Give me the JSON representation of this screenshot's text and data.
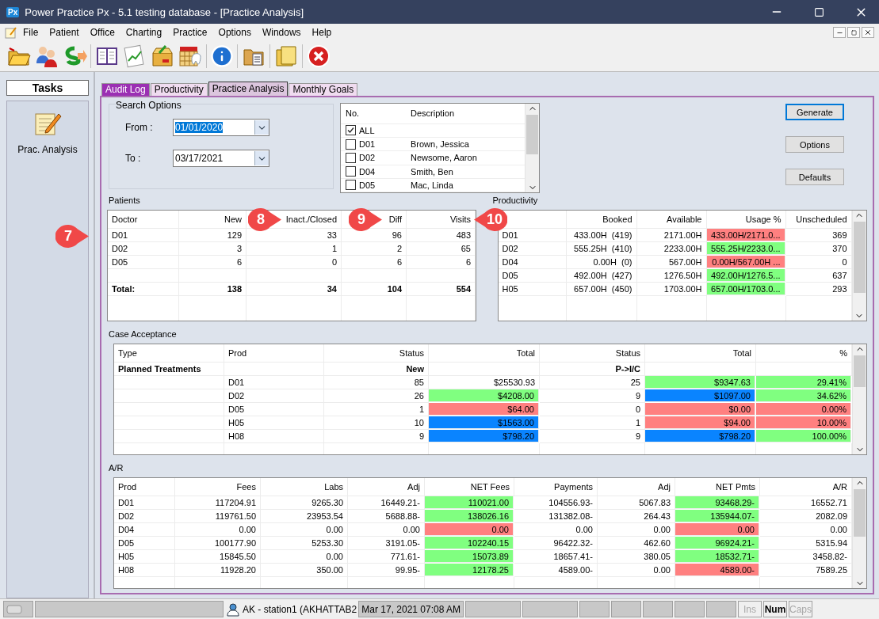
{
  "window": {
    "logo": "Px",
    "title": "Power Practice Px - 5.1 testing database - [Practice Analysis]"
  },
  "menu": [
    "File",
    "Patient",
    "Office",
    "Charting",
    "Practice",
    "Options",
    "Windows",
    "Help"
  ],
  "sidebar": {
    "title": "Tasks",
    "items": [
      {
        "label": "Prac. Analysis"
      }
    ]
  },
  "tabs": [
    {
      "label": "Audit Log",
      "selected": false,
      "color": "#9b2fb3"
    },
    {
      "label": "Productivity",
      "selected": false,
      "color": "#f0dcf0"
    },
    {
      "label": "Practice Analysis",
      "selected": true,
      "color": "#dcc6de"
    },
    {
      "label": "Monthly Goals",
      "selected": false,
      "color": "#f0dcf0"
    }
  ],
  "search": {
    "title": "Search Options",
    "fields": [
      {
        "label": "From :",
        "value": "01/01/2020",
        "selected": true
      },
      {
        "label": "To :",
        "value": "03/17/2021",
        "selected": false
      }
    ]
  },
  "doctor_list": {
    "columns": [
      "No.",
      "Description"
    ],
    "rows": [
      {
        "code": "ALL",
        "checked": true
      },
      {
        "code": "D01",
        "name": "Brown, Jessica",
        "checked": false
      },
      {
        "code": "D02",
        "name": "Newsome, Aaron",
        "checked": false
      },
      {
        "code": "D04",
        "name": "Smith, Ben",
        "checked": false
      },
      {
        "code": "D05",
        "name": "Mac, Linda",
        "checked": false
      }
    ]
  },
  "buttons": [
    {
      "label": "Generate",
      "default": true
    },
    {
      "label": "Options",
      "default": false
    },
    {
      "label": "Defaults",
      "default": false
    }
  ],
  "patients": {
    "title": "Patients",
    "columns": [
      "Doctor",
      "New",
      "Inact./Closed",
      "Diff",
      "Visits"
    ],
    "rows": [
      [
        "D01",
        "129",
        "33",
        "96",
        "483"
      ],
      [
        "D02",
        "3",
        "1",
        "2",
        "65"
      ],
      [
        "D05",
        "6",
        "0",
        "6",
        "6"
      ]
    ],
    "total": [
      "Total:",
      "138",
      "34",
      "104",
      "554"
    ]
  },
  "productivity": {
    "title": "Productivity",
    "columns": [
      "",
      "Booked",
      "Available",
      "Usage %",
      "Unscheduled"
    ],
    "rows": [
      [
        "D01",
        "433.00H  (419)",
        "2171.00H",
        {
          "text": "433.00H/2171.0...",
          "color": "#ff8080"
        },
        "369"
      ],
      [
        "D02",
        "555.25H  (410)",
        "2233.00H",
        {
          "text": "555.25H/2233.0...",
          "color": "#80ff80"
        },
        "370"
      ],
      [
        "D04",
        "0.00H  (0)",
        "567.00H",
        {
          "text": "0.00H/567.00H ...",
          "color": "#ff8080"
        },
        "0"
      ],
      [
        "D05",
        "492.00H  (427)",
        "1276.50H",
        {
          "text": "492.00H/1276.5...",
          "color": "#80ff80"
        },
        "637"
      ],
      [
        "H05",
        "657.00H  (450)",
        "1703.00H",
        {
          "text": "657.00H/1703.0...",
          "color": "#80ff80"
        },
        "293"
      ]
    ]
  },
  "case_acceptance": {
    "title": "Case Acceptance",
    "columns": [
      "Type",
      "Prod",
      "Status",
      "Total",
      "Status",
      "Total",
      "%"
    ],
    "group": {
      "type": "Planned Treatments",
      "status_new": "New",
      "status_pic": "P->I/C"
    },
    "rows": [
      [
        "",
        "D01",
        "85",
        "$25530.93",
        "25",
        {
          "text": "$9347.63",
          "color": "#80ff80"
        },
        {
          "text": "29.41%",
          "color": "#80ff80"
        }
      ],
      [
        "",
        "D02",
        "26",
        {
          "text": "$4208.00",
          "color": "#80ff80"
        },
        "9",
        {
          "text": "$1097.00",
          "color": "#0a84ff"
        },
        {
          "text": "34.62%",
          "color": "#80ff80"
        }
      ],
      [
        "",
        "D05",
        "1",
        {
          "text": "$64.00",
          "color": "#ff8080"
        },
        "0",
        {
          "text": "$0.00",
          "color": "#ff8080"
        },
        {
          "text": "0.00%",
          "color": "#ff8080"
        }
      ],
      [
        "",
        "H05",
        "10",
        {
          "text": "$1563.00",
          "color": "#0a84ff"
        },
        "1",
        {
          "text": "$94.00",
          "color": "#ff8080"
        },
        {
          "text": "10.00%",
          "color": "#ff8080"
        }
      ],
      [
        "",
        "H08",
        "9",
        {
          "text": "$798.20",
          "color": "#0a84ff"
        },
        "9",
        {
          "text": "$798.20",
          "color": "#0a84ff"
        },
        {
          "text": "100.00%",
          "color": "#80ff80"
        }
      ]
    ]
  },
  "ar": {
    "title": "A/R",
    "columns": [
      "Prod",
      "Fees",
      "Labs",
      "Adj",
      "NET Fees",
      "Payments",
      "Adj",
      "NET Pmts",
      "A/R"
    ],
    "rows": [
      [
        "D01",
        "117204.91",
        "9265.30",
        "16449.21-",
        {
          "text": "110021.00",
          "color": "#80ff80"
        },
        "104556.93-",
        "5067.83",
        {
          "text": "93468.29-",
          "color": "#80ff80"
        },
        "16552.71"
      ],
      [
        "D02",
        "119761.50",
        "23953.54",
        "5688.88-",
        {
          "text": "138026.16",
          "color": "#80ff80"
        },
        "131382.08-",
        "264.43",
        {
          "text": "135944.07-",
          "color": "#80ff80"
        },
        "2082.09"
      ],
      [
        "D04",
        "0.00",
        "0.00",
        "0.00",
        {
          "text": "0.00",
          "color": "#ff8080"
        },
        "0.00",
        "0.00",
        {
          "text": "0.00",
          "color": "#ff8080"
        },
        "0.00"
      ],
      [
        "D05",
        "100177.90",
        "5253.30",
        "3191.05-",
        {
          "text": "102240.15",
          "color": "#80ff80"
        },
        "96422.32-",
        "462.60",
        {
          "text": "96924.21-",
          "color": "#80ff80"
        },
        "5315.94"
      ],
      [
        "H05",
        "15845.50",
        "0.00",
        "771.61-",
        {
          "text": "15073.89",
          "color": "#80ff80"
        },
        "18657.41-",
        "380.05",
        {
          "text": "18532.71-",
          "color": "#80ff80"
        },
        "3458.82-"
      ],
      [
        "H08",
        "11928.20",
        "350.00",
        "99.95-",
        {
          "text": "12178.25",
          "color": "#80ff80"
        },
        "4589.00-",
        "0.00",
        {
          "text": "4589.00-",
          "color": "#ff8080"
        },
        "7589.25"
      ]
    ]
  },
  "callouts": [
    {
      "label": "7",
      "kind": "right"
    },
    {
      "label": "8",
      "kind": "right"
    },
    {
      "label": "9",
      "kind": "right"
    },
    {
      "label": "10",
      "kind": "left"
    }
  ],
  "status_bar": {
    "user": "AK - station1 (AKHATTAB2",
    "datetime": "Mar 17, 2021 07:08 AM",
    "indicators": [
      {
        "label": "Ins",
        "on": false
      },
      {
        "label": "Num",
        "on": true
      },
      {
        "label": "Caps",
        "on": false
      }
    ]
  }
}
